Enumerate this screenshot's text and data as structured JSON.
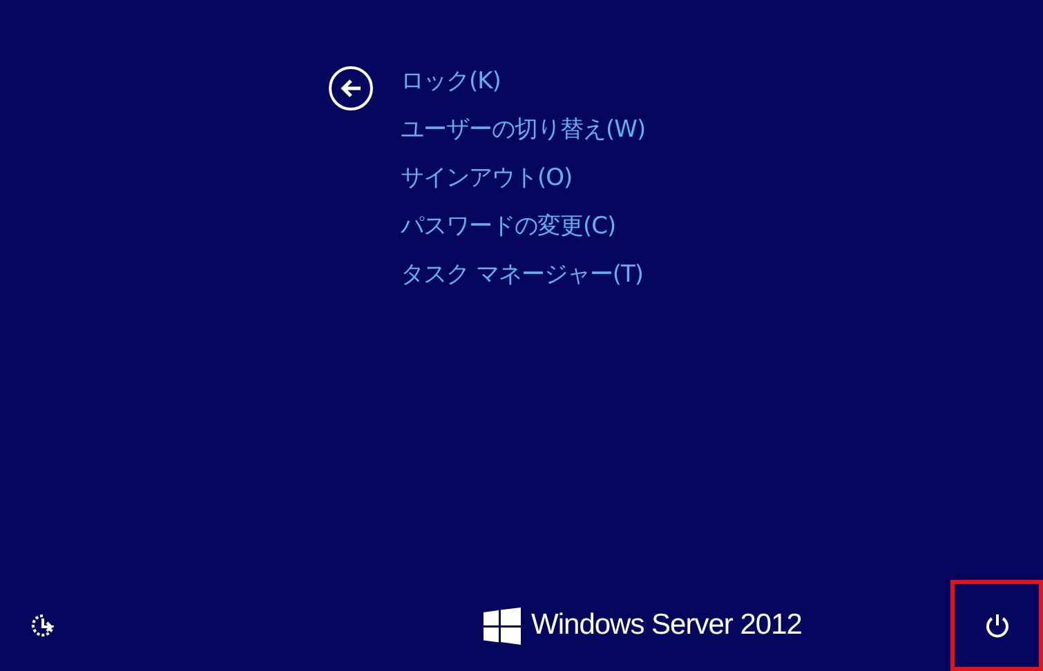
{
  "menu": {
    "items": [
      {
        "label": "ロック(K)"
      },
      {
        "label": "ユーザーの切り替え(W)"
      },
      {
        "label": "サインアウト(O)"
      },
      {
        "label": "パスワードの変更(C)"
      },
      {
        "label": "タスク マネージャー(T)"
      }
    ]
  },
  "footer": {
    "brand": "Windows Server 2012",
    "power_button": {
      "highlighted": true
    }
  }
}
